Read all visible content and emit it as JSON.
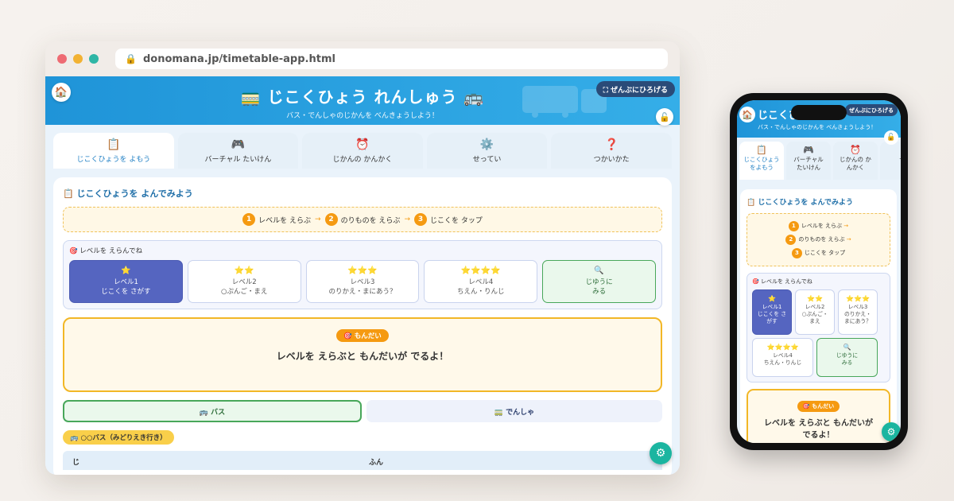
{
  "url": "donomana.jp/timetable-app.html",
  "header": {
    "title": "🚃 じこくひょう れんしゅう 🚌",
    "subtitle": "バス・でんしゃのじかんを べんきょうしよう！",
    "expand_label": "⛶ ぜんぶにひろげる",
    "home_icon": "🏠",
    "lock_icon": "🔓"
  },
  "tabs": [
    {
      "icon": "📋",
      "label": "じこくひょうを よもう"
    },
    {
      "icon": "🎮",
      "label": "バーチャル たいけん"
    },
    {
      "icon": "⏰",
      "label": "じかんの かんかく"
    },
    {
      "icon": "⚙️",
      "label": "せってい"
    },
    {
      "icon": "❓",
      "label": "つかいかた"
    }
  ],
  "main": {
    "section_title": "📋 じこくひょうを よんでみよう",
    "steps": [
      {
        "num": "1",
        "label": "レベルを えらぶ"
      },
      {
        "num": "2",
        "label": "のりものを えらぶ"
      },
      {
        "num": "3",
        "label": "じこくを タップ"
      }
    ],
    "level_heading": "🎯 レベルを えらんでね",
    "levels": [
      {
        "stars": "⭐",
        "name": "レベル1",
        "desc": "じこくを さがす"
      },
      {
        "stars": "⭐⭐",
        "name": "レベル2",
        "desc": "○ぷんご・まえ"
      },
      {
        "stars": "⭐⭐⭐",
        "name": "レベル3",
        "desc": "のりかえ・まにあう？"
      },
      {
        "stars": "⭐⭐⭐⭐",
        "name": "レベル4",
        "desc": "ちえん・りんじ"
      },
      {
        "stars": "🔍",
        "name": "じゆうに",
        "desc": "みる"
      }
    ],
    "problem_badge": "🎯 もんだい",
    "problem_text": "レベルを えらぶと もんだいが でるよ！",
    "vehicles": {
      "bus": "🚌 バス",
      "train": "🚃 でんしゃ"
    },
    "route_tag": "🚌 ○○バス（みどりえき行き）",
    "table_headers": {
      "hour": "じ",
      "minute": "ふん"
    },
    "gear_icon": "⚙"
  },
  "phone": {
    "title": "じこくひょう",
    "subtitle": "バス・でんしゃのじかんを べんきょうしよう！",
    "expand_label": "ぜんぶにひろげる",
    "tabs": [
      {
        "icon": "📋",
        "label1": "じこくひょう",
        "label2": "をよもう"
      },
      {
        "icon": "🎮",
        "label1": "バーチャル",
        "label2": "たいけん"
      },
      {
        "icon": "⏰",
        "label1": "じかんの か",
        "label2": "んかく"
      },
      {
        "icon": "",
        "label1": "せ",
        "label2": ""
      }
    ],
    "levels": [
      {
        "stars": "⭐",
        "name": "レベル1",
        "desc1": "じこくを さ",
        "desc2": "がす"
      },
      {
        "stars": "⭐⭐",
        "name": "レベル2",
        "desc1": "○ぷんご・",
        "desc2": "まえ"
      },
      {
        "stars": "⭐⭐⭐",
        "name": "レベル3",
        "desc1": "のりかえ・",
        "desc2": "まにあう？"
      },
      {
        "stars": "⭐⭐⭐⭐",
        "name": "レベル4",
        "desc1": "ちえん・りんじ",
        "desc2": ""
      },
      {
        "stars": "🔍",
        "name": "じゆうに",
        "desc1": "みる",
        "desc2": ""
      }
    ],
    "problem_line1": "レベルを えらぶと もんだいが",
    "problem_line2": "でるよ！"
  }
}
